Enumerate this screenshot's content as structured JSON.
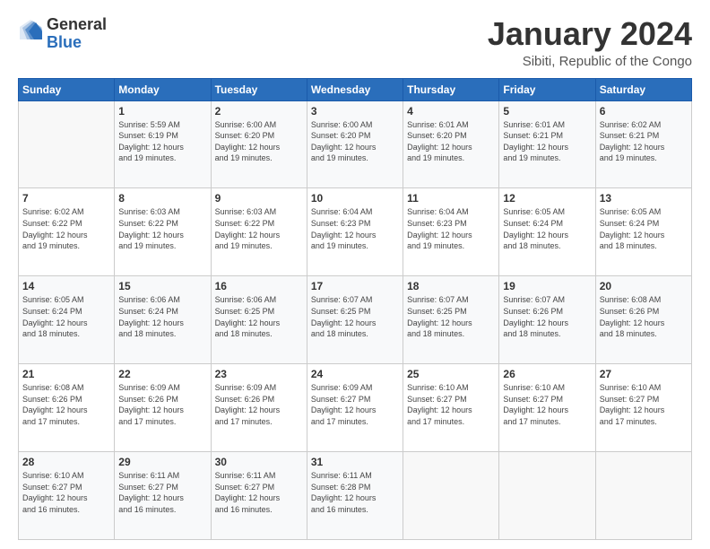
{
  "logo": {
    "general": "General",
    "blue": "Blue"
  },
  "header": {
    "month": "January 2024",
    "location": "Sibiti, Republic of the Congo"
  },
  "weekdays": [
    "Sunday",
    "Monday",
    "Tuesday",
    "Wednesday",
    "Thursday",
    "Friday",
    "Saturday"
  ],
  "weeks": [
    [
      {
        "day": "",
        "info": ""
      },
      {
        "day": "1",
        "info": "Sunrise: 5:59 AM\nSunset: 6:19 PM\nDaylight: 12 hours\nand 19 minutes."
      },
      {
        "day": "2",
        "info": "Sunrise: 6:00 AM\nSunset: 6:20 PM\nDaylight: 12 hours\nand 19 minutes."
      },
      {
        "day": "3",
        "info": "Sunrise: 6:00 AM\nSunset: 6:20 PM\nDaylight: 12 hours\nand 19 minutes."
      },
      {
        "day": "4",
        "info": "Sunrise: 6:01 AM\nSunset: 6:20 PM\nDaylight: 12 hours\nand 19 minutes."
      },
      {
        "day": "5",
        "info": "Sunrise: 6:01 AM\nSunset: 6:21 PM\nDaylight: 12 hours\nand 19 minutes."
      },
      {
        "day": "6",
        "info": "Sunrise: 6:02 AM\nSunset: 6:21 PM\nDaylight: 12 hours\nand 19 minutes."
      }
    ],
    [
      {
        "day": "7",
        "info": "Sunrise: 6:02 AM\nSunset: 6:22 PM\nDaylight: 12 hours\nand 19 minutes."
      },
      {
        "day": "8",
        "info": "Sunrise: 6:03 AM\nSunset: 6:22 PM\nDaylight: 12 hours\nand 19 minutes."
      },
      {
        "day": "9",
        "info": "Sunrise: 6:03 AM\nSunset: 6:22 PM\nDaylight: 12 hours\nand 19 minutes."
      },
      {
        "day": "10",
        "info": "Sunrise: 6:04 AM\nSunset: 6:23 PM\nDaylight: 12 hours\nand 19 minutes."
      },
      {
        "day": "11",
        "info": "Sunrise: 6:04 AM\nSunset: 6:23 PM\nDaylight: 12 hours\nand 19 minutes."
      },
      {
        "day": "12",
        "info": "Sunrise: 6:05 AM\nSunset: 6:24 PM\nDaylight: 12 hours\nand 18 minutes."
      },
      {
        "day": "13",
        "info": "Sunrise: 6:05 AM\nSunset: 6:24 PM\nDaylight: 12 hours\nand 18 minutes."
      }
    ],
    [
      {
        "day": "14",
        "info": "Sunrise: 6:05 AM\nSunset: 6:24 PM\nDaylight: 12 hours\nand 18 minutes."
      },
      {
        "day": "15",
        "info": "Sunrise: 6:06 AM\nSunset: 6:24 PM\nDaylight: 12 hours\nand 18 minutes."
      },
      {
        "day": "16",
        "info": "Sunrise: 6:06 AM\nSunset: 6:25 PM\nDaylight: 12 hours\nand 18 minutes."
      },
      {
        "day": "17",
        "info": "Sunrise: 6:07 AM\nSunset: 6:25 PM\nDaylight: 12 hours\nand 18 minutes."
      },
      {
        "day": "18",
        "info": "Sunrise: 6:07 AM\nSunset: 6:25 PM\nDaylight: 12 hours\nand 18 minutes."
      },
      {
        "day": "19",
        "info": "Sunrise: 6:07 AM\nSunset: 6:26 PM\nDaylight: 12 hours\nand 18 minutes."
      },
      {
        "day": "20",
        "info": "Sunrise: 6:08 AM\nSunset: 6:26 PM\nDaylight: 12 hours\nand 18 minutes."
      }
    ],
    [
      {
        "day": "21",
        "info": "Sunrise: 6:08 AM\nSunset: 6:26 PM\nDaylight: 12 hours\nand 17 minutes."
      },
      {
        "day": "22",
        "info": "Sunrise: 6:09 AM\nSunset: 6:26 PM\nDaylight: 12 hours\nand 17 minutes."
      },
      {
        "day": "23",
        "info": "Sunrise: 6:09 AM\nSunset: 6:26 PM\nDaylight: 12 hours\nand 17 minutes."
      },
      {
        "day": "24",
        "info": "Sunrise: 6:09 AM\nSunset: 6:27 PM\nDaylight: 12 hours\nand 17 minutes."
      },
      {
        "day": "25",
        "info": "Sunrise: 6:10 AM\nSunset: 6:27 PM\nDaylight: 12 hours\nand 17 minutes."
      },
      {
        "day": "26",
        "info": "Sunrise: 6:10 AM\nSunset: 6:27 PM\nDaylight: 12 hours\nand 17 minutes."
      },
      {
        "day": "27",
        "info": "Sunrise: 6:10 AM\nSunset: 6:27 PM\nDaylight: 12 hours\nand 17 minutes."
      }
    ],
    [
      {
        "day": "28",
        "info": "Sunrise: 6:10 AM\nSunset: 6:27 PM\nDaylight: 12 hours\nand 16 minutes."
      },
      {
        "day": "29",
        "info": "Sunrise: 6:11 AM\nSunset: 6:27 PM\nDaylight: 12 hours\nand 16 minutes."
      },
      {
        "day": "30",
        "info": "Sunrise: 6:11 AM\nSunset: 6:27 PM\nDaylight: 12 hours\nand 16 minutes."
      },
      {
        "day": "31",
        "info": "Sunrise: 6:11 AM\nSunset: 6:28 PM\nDaylight: 12 hours\nand 16 minutes."
      },
      {
        "day": "",
        "info": ""
      },
      {
        "day": "",
        "info": ""
      },
      {
        "day": "",
        "info": ""
      }
    ]
  ]
}
